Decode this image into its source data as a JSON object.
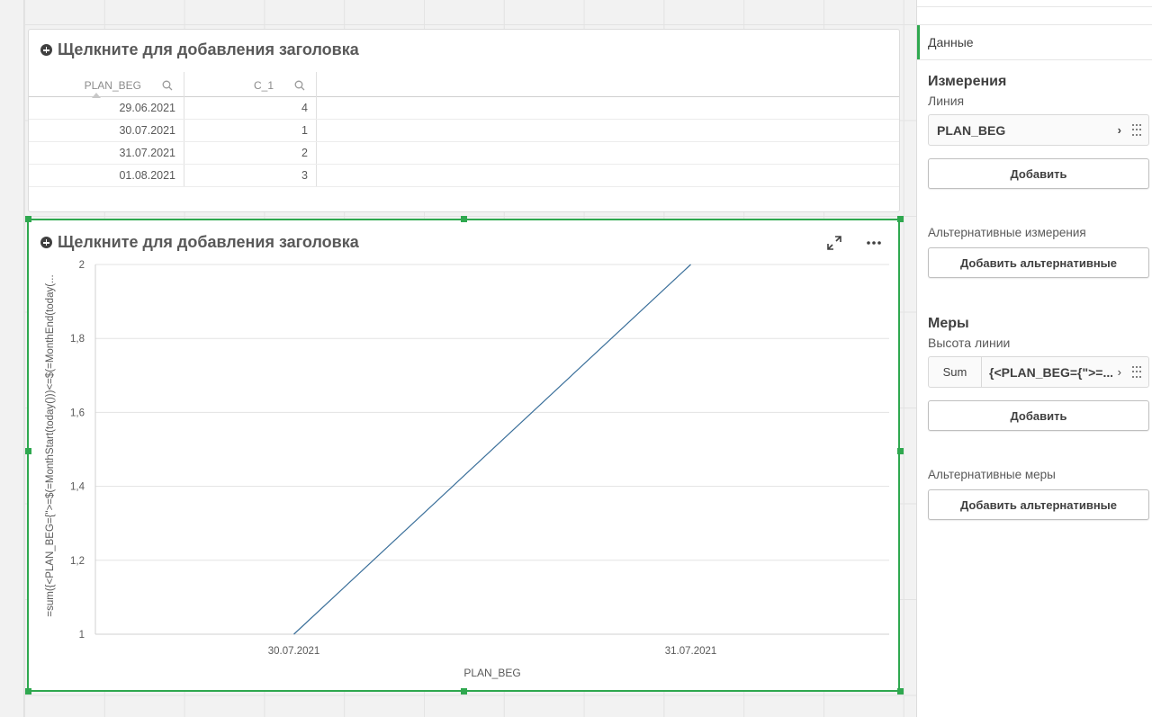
{
  "table": {
    "title": "Щелкните для добавления заголовка",
    "columns": [
      "PLAN_BEG",
      "C_1"
    ],
    "rows": [
      [
        "29.06.2021",
        "4"
      ],
      [
        "30.07.2021",
        "1"
      ],
      [
        "31.07.2021",
        "2"
      ],
      [
        "01.08.2021",
        "3"
      ]
    ]
  },
  "chart": {
    "title": "Щелкните для добавления заголовка",
    "expand_icon": "expand-icon",
    "more_icon": "more-options-icon"
  },
  "chart_data": {
    "type": "line",
    "title": "",
    "xlabel": "PLAN_BEG",
    "ylabel": "=sum({<PLAN_BEG={\">=$(=MonthStart(today()))<=$(=MonthEnd(today(...",
    "categories": [
      "30.07.2021",
      "31.07.2021"
    ],
    "series": [
      {
        "values": [
          1,
          2
        ]
      }
    ],
    "ylim": [
      1,
      2
    ],
    "yticks": [
      "1",
      "1,2",
      "1,4",
      "1,6",
      "1,8",
      "2"
    ],
    "grid": true,
    "line_color": "#3a6f9a"
  },
  "panel": {
    "tab_label": "Данные",
    "dimensions_title": "Измерения",
    "dimension_sub": "Линия",
    "dimension_field": "PLAN_BEG",
    "add_label": "Добавить",
    "alt_dimensions_label": "Альтернативные измерения",
    "add_alt_label": "Добавить альтернативные",
    "measures_title": "Меры",
    "measure_sub": "Высота линии",
    "measure_agg": "Sum",
    "measure_expr": "{<PLAN_BEG={\">=...",
    "add_measure_label": "Добавить",
    "alt_measures_label": "Альтернативные меры",
    "add_alt_measure_label": "Добавить альтернативные"
  },
  "colors": {
    "selection": "#2fa84f",
    "line": "#3a6f9a"
  }
}
